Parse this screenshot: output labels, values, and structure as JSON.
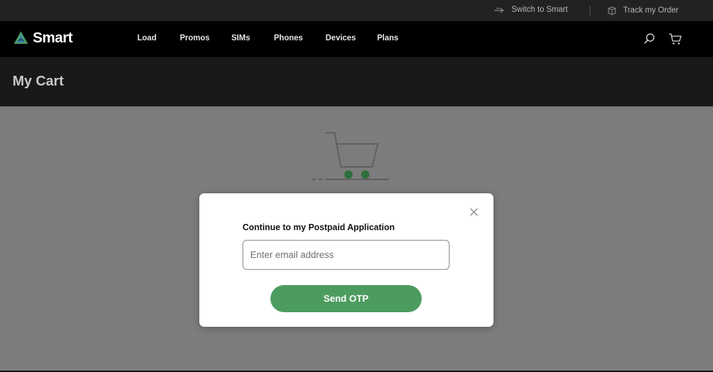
{
  "utility_bar": {
    "switch_label": "Switch to Smart",
    "track_label": "Track my Order"
  },
  "nav": {
    "brand": "Smart",
    "items": [
      {
        "label": "Load"
      },
      {
        "label": "Promos"
      },
      {
        "label": "SIMs"
      },
      {
        "label": "Phones"
      },
      {
        "label": "Devices"
      },
      {
        "label": "Plans"
      }
    ]
  },
  "page": {
    "title": "My Cart"
  },
  "modal": {
    "title": "Continue to my Postpaid Application",
    "email_placeholder": "Enter email address",
    "email_value": "",
    "send_label": "Send OTP"
  },
  "colors": {
    "brand_green": "#4d9c5f",
    "cart_wheel_green": "#2e6e3c",
    "overlay_gray": "#7c7c7c"
  }
}
